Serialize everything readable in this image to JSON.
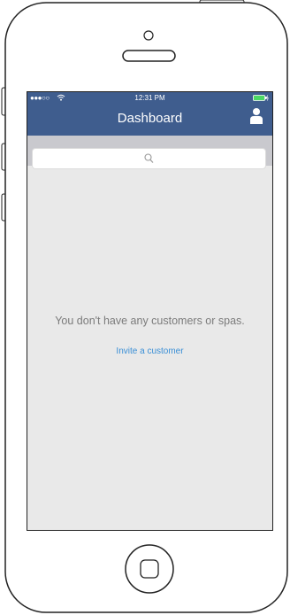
{
  "status_bar": {
    "signal": "●●●○○",
    "time": "12:31 PM",
    "wifi_icon": "wifi-icon",
    "battery_icon": "battery-icon"
  },
  "navbar": {
    "title": "Dashboard",
    "profile_icon": "person-icon",
    "background": "#3f5d8e"
  },
  "search": {
    "placeholder": "",
    "icon": "search-icon"
  },
  "empty_state": {
    "message": "You don't have any customers or spas.",
    "action_label": "Invite a customer",
    "link_color": "#3a8fd6"
  }
}
